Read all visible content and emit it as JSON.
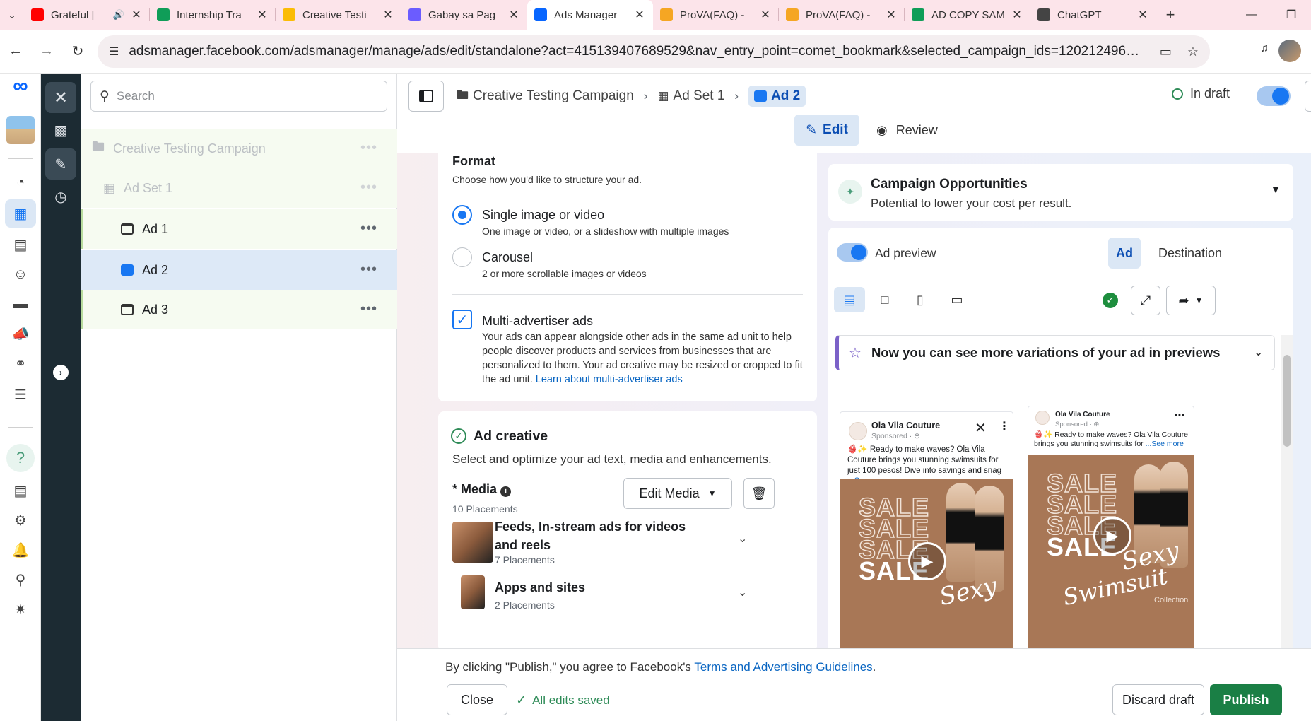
{
  "browser": {
    "tabs": [
      {
        "title": "Grateful |",
        "fav_color": "#ff0000",
        "extra_icon": "speaker-icon"
      },
      {
        "title": "Internship Tra",
        "fav_color": "#0f9d58"
      },
      {
        "title": "Creative Testi",
        "fav_color": "#fbbc04"
      },
      {
        "title": "Gabay sa Pag",
        "fav_color": "#6b5cff"
      },
      {
        "title": "Ads Manager",
        "fav_color": "#0866ff",
        "active": true
      },
      {
        "title": "ProVA(FAQ) -",
        "fav_color": "#f5a623"
      },
      {
        "title": "ProVA(FAQ) -",
        "fav_color": "#f5a623"
      },
      {
        "title": "AD COPY SAM",
        "fav_color": "#0f9d58"
      },
      {
        "title": "ChatGPT",
        "fav_color": "#444444"
      }
    ],
    "url": "adsmanager.facebook.com/adsmanager/manage/ads/edit/standalone?act=415139407689529&nav_entry_point=comet_bookmark&selected_campaign_ids=120212496279170240&selected_..."
  },
  "tree": {
    "search_placeholder": "Search",
    "campaign": "Creative Testing Campaign",
    "adset": "Ad Set 1",
    "ads": [
      "Ad 1",
      "Ad 2",
      "Ad 3"
    ],
    "dots": "•••"
  },
  "topbar": {
    "crumb_campaign": "Creative Testing Campaign",
    "crumb_adset": "Ad Set 1",
    "crumb_ad": "Ad 2",
    "status": "In draft",
    "edit_label": "Edit",
    "review_label": "Review"
  },
  "format": {
    "title": "Format",
    "subtitle": "Choose how you'd like to structure your ad.",
    "single_title": "Single image or video",
    "single_desc": "One image or video, or a slideshow with multiple images",
    "carousel_title": "Carousel",
    "carousel_desc": "2 or more scrollable images or videos",
    "multi_title": "Multi-advertiser ads",
    "multi_desc": "Your ads can appear alongside other ads in the same ad unit to help people discover products and services from businesses that are personalized to them. Your ad creative may be resized or cropped to fit the ad unit.",
    "multi_link": "Learn about multi-advertiser ads"
  },
  "creative": {
    "title": "Ad creative",
    "subtitle": "Select and optimize your ad text, media and enhancements.",
    "media_label": "* Media",
    "media_sub": "10 Placements",
    "edit_media": "Edit Media",
    "placement1_title": "Feeds, In-stream ads for videos and reels",
    "placement1_sub": "7 Placements",
    "placement2_title": "Apps and sites",
    "placement2_sub": "2 Placements"
  },
  "opportunities": {
    "title": "Campaign Opportunities",
    "subtitle": "Potential to lower your cost per result."
  },
  "preview": {
    "label": "Ad preview",
    "tab_ad": "Ad",
    "tab_destination": "Destination",
    "banner": "Now you can see more variations of your ad in previews",
    "page_name": "Ola Vila Couture",
    "sponsored": "Sponsored · ⊕",
    "copy1": "👙✨ Ready to make waves? Ola Vila Couture brings you stunning swimsuits for just 100 pesos! Dive into savings and snag",
    "copy2": "👙✨ Ready to make waves? Ola Vila Couture brings you stunning swimsuits for",
    "see_more": "...See more",
    "sale_word": "SALE",
    "script_word": "Sexy",
    "script_word2": "Swimsuit",
    "collection": "Collection"
  },
  "footer": {
    "agree_prefix": "By clicking \"Publish,\" you agree to Facebook's ",
    "agree_link": "Terms and Advertising Guidelines",
    "agree_suffix": ".",
    "close": "Close",
    "saved": "All edits saved",
    "discard": "Discard draft",
    "publish": "Publish"
  },
  "colors": {
    "brand_blue": "#1877f2",
    "publish_green": "#1a7f45",
    "rail_dark": "#1c2b33",
    "tab_strip": "#fce4ea"
  }
}
